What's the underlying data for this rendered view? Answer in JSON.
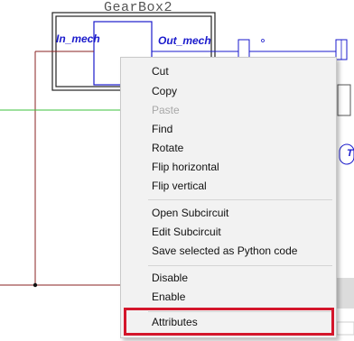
{
  "diagram": {
    "block_title": "GearBox2",
    "in_port": "In_mech",
    "out_port": "Out_mech",
    "right_label_fragment": "T",
    "colors": {
      "wire_red": "#8a2020",
      "wire_green": "#3cc03c",
      "port_blue": "#1a1acc"
    }
  },
  "context_menu": {
    "groups": [
      [
        "Cut",
        "Copy",
        "Paste",
        "Find",
        "Rotate",
        "Flip horizontal",
        "Flip vertical"
      ],
      [
        "Open Subcircuit",
        "Edit Subcircuit",
        "Save selected as Python code"
      ],
      [
        "Disable",
        "Enable"
      ],
      [
        "Attributes"
      ]
    ],
    "items": {
      "cut": "Cut",
      "copy": "Copy",
      "paste": "Paste",
      "find": "Find",
      "rotate": "Rotate",
      "flip_horizontal": "Flip horizontal",
      "flip_vertical": "Flip vertical",
      "open_subcircuit": "Open Subcircuit",
      "edit_subcircuit": "Edit Subcircuit",
      "save_python": "Save selected as Python code",
      "disable": "Disable",
      "enable": "Enable",
      "attributes": "Attributes"
    },
    "disabled": [
      "Paste"
    ],
    "highlighted_item": "Attributes",
    "highlight_color": "#d4162b"
  }
}
